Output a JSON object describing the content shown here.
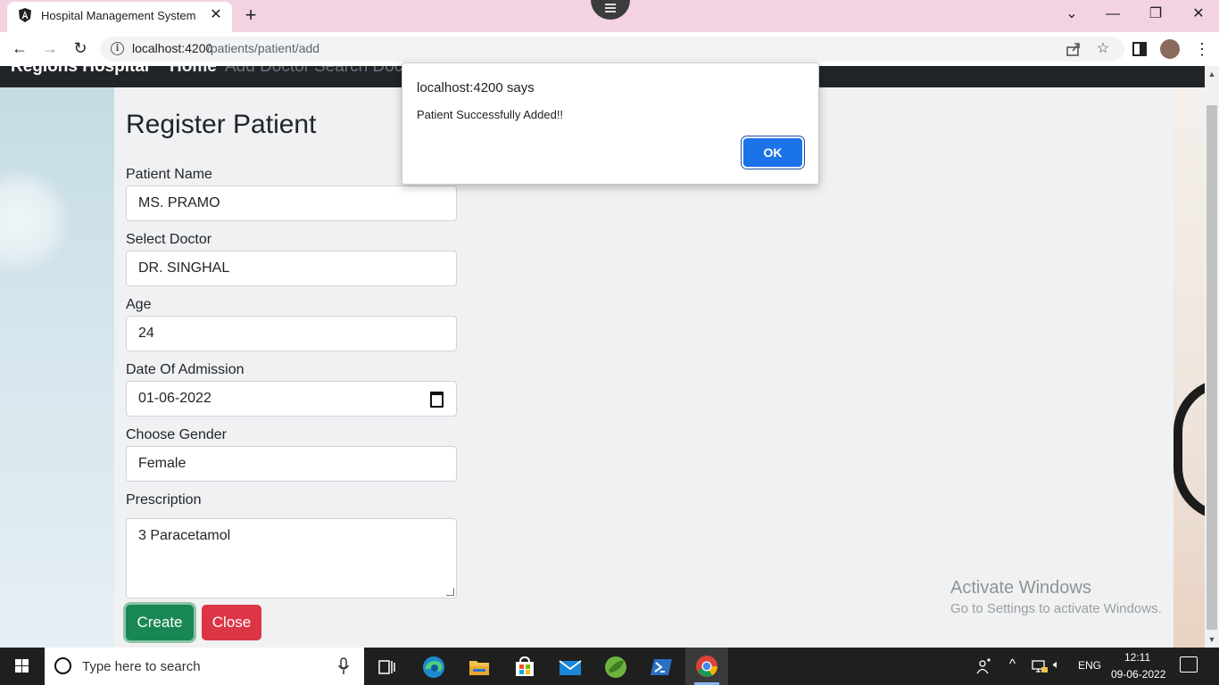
{
  "browser": {
    "tab_title": "Hospital Management System",
    "tab_close": "✕",
    "new_tab": "+",
    "url_host": "localhost:4200",
    "url_path": "/patients/patient/add",
    "window_controls": {
      "dropdown": "⌄",
      "minimize": "—",
      "restore": "❐",
      "close": "✕"
    },
    "nav": {
      "back": "←",
      "forward": "→",
      "reload": "↻"
    }
  },
  "navbar": {
    "brand": "Regions Hospital",
    "items": [
      "Home",
      "Add Doctor",
      "Search Doctor"
    ]
  },
  "form": {
    "title": "Register Patient",
    "fields": [
      {
        "label": "Patient Name",
        "value": "MS. PRAMO"
      },
      {
        "label": "Select Doctor",
        "value": "DR. SINGHAL"
      },
      {
        "label": "Age",
        "value": "24"
      },
      {
        "label": "Date Of Admission",
        "value": "01-06-2022"
      },
      {
        "label": "Choose Gender",
        "value": "Female"
      },
      {
        "label": "Prescription",
        "value": "3 Paracetamol"
      }
    ],
    "create_label": "Create",
    "close_label": "Close"
  },
  "dialog": {
    "title": "localhost:4200 says",
    "message": "Patient Successfully Added!!",
    "ok_label": "OK"
  },
  "watermark": {
    "title": "Activate Windows",
    "subtitle": "Go to Settings to activate Windows."
  },
  "taskbar": {
    "search_placeholder": "Type here to search",
    "tray_lang": "ENG",
    "time": "12:11",
    "date": "09-06-2022"
  },
  "colors": {
    "create": "#198754",
    "close": "#dc3545",
    "ok": "#1a73e8",
    "titlebar": "#f3d3e2"
  }
}
